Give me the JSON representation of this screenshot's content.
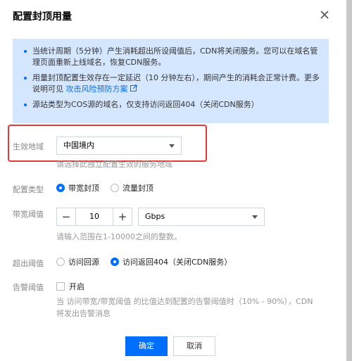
{
  "dialog": {
    "title": "配置封顶用量",
    "info": {
      "item1": "当统计周期（5分钟）产生消耗超出所设阈值后，CDN将关闭服务。您可以在域名管理页面重新上线域名，恢复CDN服务。",
      "item2_text": "用量封顶配置生效存在一定延迟（10 分钟左右），期间产生的消耗会正常计费。更多说明可见",
      "item2_link": "攻击风险预防方案",
      "item3": "源站类型为COS源的域名，仅支持访问返回404（关闭CDN服务）"
    },
    "region": {
      "label": "生效地域",
      "value": "中国境内",
      "hint": "请选择此独立配置生效的服务地域"
    },
    "config_type": {
      "label": "配置类型",
      "options": [
        "带宽封顶",
        "流量封顶"
      ],
      "selected": "带宽封顶"
    },
    "bandwidth": {
      "label": "带宽阈值",
      "minus": "−",
      "value": "10",
      "plus": "+",
      "unit": "Gbps",
      "hint": "请输入范围在1-10000之间的整数。"
    },
    "overflow": {
      "label": "超出阈值",
      "options": [
        "访问回源",
        "访问返回404（关闭CDN服务）"
      ],
      "selected": "访问返回404（关闭CDN服务）"
    },
    "alert": {
      "label": "告警阈值",
      "checkbox_label": "开启",
      "checked": false,
      "hint": "当 访问带宽/带宽阈值 的比值达到配置的告警阈值时（10% - 90%），CDN将发出告警消息"
    },
    "buttons": {
      "confirm": "确定",
      "cancel": "取消"
    }
  }
}
